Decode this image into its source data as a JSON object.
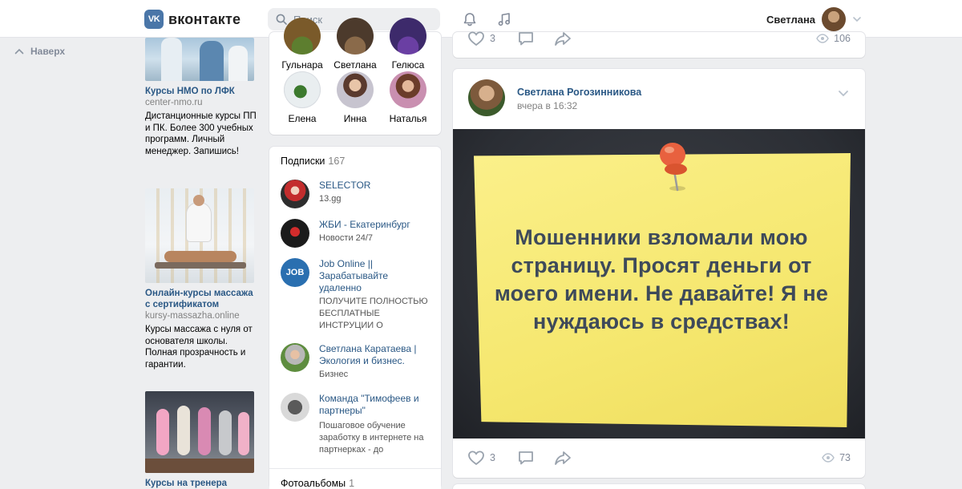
{
  "header": {
    "logo_mark": "VK",
    "logo_text": "вконтакте",
    "search_placeholder": "Поиск",
    "user_name": "Светлана"
  },
  "nav": {
    "up_label": "Наверх"
  },
  "ads": [
    {
      "title": "Курсы НМО по ЛФК",
      "domain": "center-nmo.ru",
      "text": "Дистанционные курсы ПП и ПК. Более 300 учебных программ. Личный менеджер. Запишись!"
    },
    {
      "title": "Онлайн-курсы массажа с сертификатом",
      "domain": "kursy-massazha.online",
      "text": "Курсы массажа с нуля от основателя школы. Полная прозрачность и гарантии."
    },
    {
      "title": "Курсы на тренера",
      "domain": "",
      "text": ""
    }
  ],
  "friends": [
    {
      "name": "Гульнара"
    },
    {
      "name": "Светлана"
    },
    {
      "name": "Гелюса"
    },
    {
      "name": "Елена"
    },
    {
      "name": "Инна"
    },
    {
      "name": "Наталья"
    }
  ],
  "subscriptions": {
    "label": "Подписки",
    "count": "167",
    "items": [
      {
        "name": "SELECTOR",
        "desc": "13.gg"
      },
      {
        "name": "ЖБИ - Екатеринбург",
        "desc": "Новости 24/7"
      },
      {
        "name": "Job Online || Зарабатывайте удаленно",
        "desc": "ПОЛУЧИТЕ ПОЛНОСТЬЮ БЕСПЛАТНЫЕ ИНСТРУЦИИ О"
      },
      {
        "name": "Светлана Каратаева | Экология и бизнес.",
        "desc": "Бизнес"
      },
      {
        "name": "Команда \"Тимофеев и партнеры\"",
        "desc": "Пошаговое обучение заработку в интернете на партнерках - до"
      }
    ],
    "job_badge": "JOB"
  },
  "albums": {
    "label": "Фотоальбомы",
    "count": "1"
  },
  "prev_post": {
    "likes": "3",
    "views": "106"
  },
  "post": {
    "author": "Светлана Рогозинникова",
    "time": "вчера в 16:32",
    "image_text": "Мошенники взломали мою страницу. Просят деньги от моего имени. Не давайте! Я не нуждаюсь в средствах!",
    "likes": "3",
    "views": "73"
  },
  "colors": {
    "accent": "#4a76a8",
    "link": "#2a5885",
    "muted": "#828a99",
    "sticky": "#f5e76e",
    "pin": "#e8613f"
  }
}
